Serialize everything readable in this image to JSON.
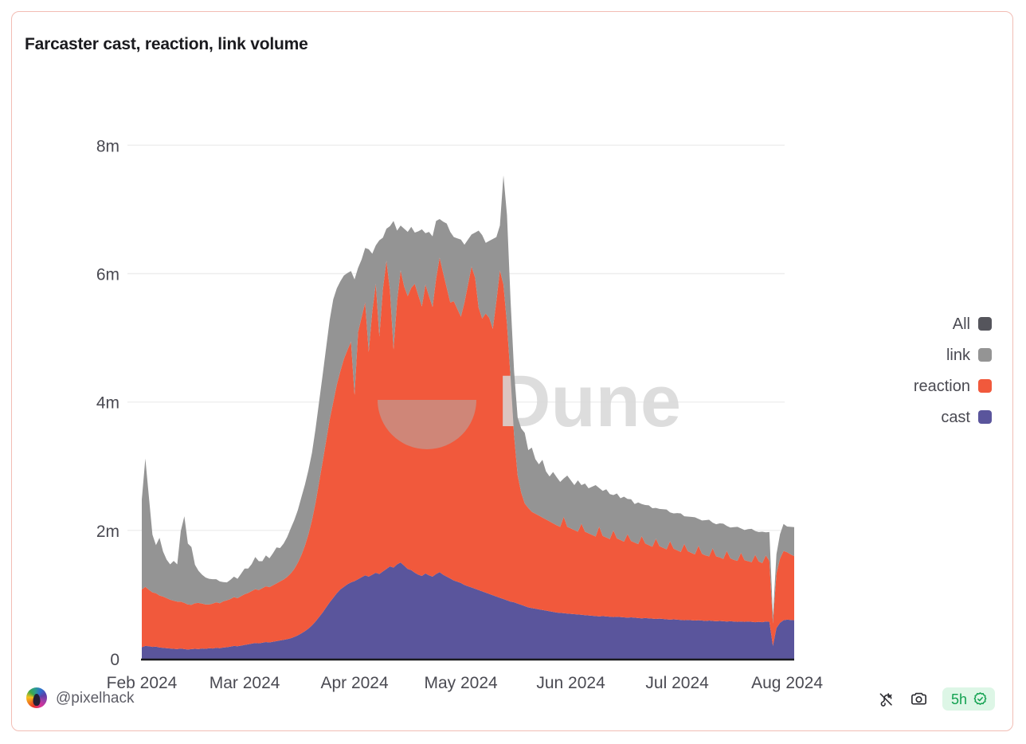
{
  "card": {
    "border_color": "#f2bdb4",
    "background": "#ffffff"
  },
  "header": {
    "title": "Farcaster cast, reaction, link volume"
  },
  "watermark": {
    "text": "Dune",
    "color": "#d8d8d8"
  },
  "legend": {
    "position": "right",
    "items": [
      {
        "label": "All",
        "color": "#55555c"
      },
      {
        "label": "link",
        "color": "#949494"
      },
      {
        "label": "reaction",
        "color": "#f1593c"
      },
      {
        "label": "cast",
        "color": "#5a559c"
      }
    ]
  },
  "footer": {
    "author": "@pixelhack",
    "avatar_icon": "rainbow-avatar-icon",
    "tools": [
      {
        "name": "embed-plug-icon",
        "label": "Embed"
      },
      {
        "name": "camera-icon",
        "label": "Screenshot"
      }
    ],
    "freshness": {
      "value": "5h",
      "icon": "verified-badge-icon",
      "color": "#12a150",
      "background": "#ddf6e6"
    }
  },
  "chart_data": {
    "type": "area",
    "stacked": true,
    "title": "Farcaster cast, reaction, link volume",
    "xlabel": "",
    "ylabel": "",
    "grid": true,
    "legend_position": "right",
    "xlim": [
      "2024-02-01",
      "2024-08-10"
    ],
    "ylim": [
      0,
      8600000
    ],
    "ytick_values": [
      0,
      2000000,
      4000000,
      6000000,
      8000000
    ],
    "ytick_labels": [
      "0",
      "2m",
      "4m",
      "6m",
      "8m"
    ],
    "xtick_labels": [
      "Feb 2024",
      "Mar 2024",
      "Apr 2024",
      "May 2024",
      "Jun 2024",
      "Jul 2024",
      "Aug 2024"
    ],
    "xtick_positions": [
      0,
      29,
      60,
      90,
      121,
      151,
      182
    ],
    "x_unit": "days since 2024-02-01",
    "series": [
      {
        "name": "cast",
        "color": "#5a559c",
        "values": [
          180000,
          200000,
          195000,
          185000,
          190000,
          175000,
          170000,
          165000,
          160000,
          155000,
          150000,
          160000,
          150000,
          145000,
          150000,
          155000,
          150000,
          160000,
          155000,
          165000,
          160000,
          170000,
          165000,
          175000,
          180000,
          190000,
          200000,
          195000,
          205000,
          215000,
          225000,
          235000,
          245000,
          240000,
          250000,
          260000,
          255000,
          265000,
          275000,
          285000,
          295000,
          305000,
          320000,
          340000,
          365000,
          395000,
          430000,
          470000,
          520000,
          580000,
          650000,
          720000,
          800000,
          880000,
          950000,
          1020000,
          1080000,
          1120000,
          1160000,
          1190000,
          1210000,
          1240000,
          1270000,
          1300000,
          1280000,
          1310000,
          1340000,
          1320000,
          1360000,
          1400000,
          1440000,
          1420000,
          1470000,
          1500000,
          1450000,
          1400000,
          1380000,
          1340000,
          1310000,
          1290000,
          1330000,
          1300000,
          1280000,
          1320000,
          1350000,
          1310000,
          1280000,
          1250000,
          1220000,
          1200000,
          1180000,
          1150000,
          1130000,
          1110000,
          1090000,
          1070000,
          1050000,
          1030000,
          1010000,
          990000,
          970000,
          950000,
          930000,
          910000,
          890000,
          880000,
          860000,
          840000,
          820000,
          800000,
          790000,
          780000,
          770000,
          760000,
          750000,
          740000,
          730000,
          720000,
          715000,
          710000,
          705000,
          700000,
          695000,
          690000,
          685000,
          680000,
          675000,
          670000,
          665000,
          660000,
          665000,
          660000,
          655000,
          650000,
          655000,
          650000,
          645000,
          640000,
          645000,
          640000,
          635000,
          630000,
          635000,
          630000,
          625000,
          620000,
          625000,
          620000,
          615000,
          610000,
          615000,
          610000,
          605000,
          600000,
          605000,
          600000,
          595000,
          600000,
          595000,
          590000,
          595000,
          590000,
          585000,
          590000,
          585000,
          580000,
          585000,
          580000,
          575000,
          580000,
          575000,
          580000,
          575000,
          570000,
          575000,
          570000,
          580000,
          575000,
          200000,
          480000,
          560000,
          600000,
          610000,
          605000,
          600000
        ]
      },
      {
        "name": "reaction",
        "color": "#f1593c",
        "values": [
          900000,
          920000,
          880000,
          850000,
          830000,
          810000,
          800000,
          780000,
          760000,
          750000,
          740000,
          730000,
          720000,
          700000,
          690000,
          710000,
          720000,
          700000,
          690000,
          680000,
          700000,
          710000,
          700000,
          720000,
          730000,
          740000,
          760000,
          750000,
          770000,
          790000,
          800000,
          820000,
          840000,
          830000,
          850000,
          870000,
          860000,
          880000,
          900000,
          920000,
          940000,
          970000,
          1010000,
          1060000,
          1130000,
          1220000,
          1330000,
          1470000,
          1640000,
          1850000,
          2100000,
          2350000,
          2600000,
          2850000,
          3050000,
          3250000,
          3400000,
          3550000,
          3650000,
          3750000,
          2900000,
          3850000,
          4050000,
          4250000,
          3500000,
          4100000,
          4500000,
          3700000,
          4400000,
          4800000,
          4300000,
          3400000,
          4100000,
          4550000,
          4350000,
          4250000,
          4400000,
          4500000,
          4350000,
          4200000,
          4500000,
          4350000,
          4200000,
          4600000,
          4900000,
          4700000,
          4500000,
          4300000,
          4350000,
          4250000,
          4150000,
          4400000,
          4700000,
          5000000,
          4850000,
          4400000,
          4250000,
          4350000,
          4300000,
          4150000,
          4600000,
          5100000,
          4900000,
          4300000,
          3500000,
          2600000,
          2000000,
          1750000,
          1600000,
          1550000,
          1500000,
          1480000,
          1460000,
          1440000,
          1420000,
          1400000,
          1380000,
          1360000,
          1340000,
          1500000,
          1350000,
          1330000,
          1310000,
          1290000,
          1420000,
          1300000,
          1280000,
          1260000,
          1240000,
          1400000,
          1250000,
          1230000,
          1210000,
          1350000,
          1220000,
          1200000,
          1180000,
          1300000,
          1190000,
          1170000,
          1150000,
          1280000,
          1160000,
          1140000,
          1120000,
          1250000,
          1130000,
          1110000,
          1090000,
          1220000,
          1100000,
          1080000,
          1060000,
          1190000,
          1070000,
          1050000,
          1030000,
          1160000,
          1040000,
          1020000,
          1000000,
          1130000,
          1010000,
          990000,
          970000,
          1100000,
          980000,
          960000,
          950000,
          1070000,
          960000,
          940000,
          930000,
          1050000,
          940000,
          920000,
          1030000,
          950000,
          350000,
          850000,
          1000000,
          1080000,
          1050000,
          1020000,
          1000000
        ]
      },
      {
        "name": "link",
        "color": "#949494",
        "values": [
          1400000,
          2000000,
          1450000,
          900000,
          750000,
          900000,
          700000,
          600000,
          550000,
          620000,
          580000,
          1100000,
          1350000,
          950000,
          900000,
          600000,
          500000,
          450000,
          420000,
          400000,
          380000,
          360000,
          340000,
          300000,
          280000,
          300000,
          320000,
          300000,
          350000,
          400000,
          380000,
          420000,
          500000,
          450000,
          420000,
          480000,
          450000,
          500000,
          560000,
          520000,
          560000,
          620000,
          700000,
          760000,
          820000,
          900000,
          950000,
          1000000,
          1050000,
          1150000,
          1250000,
          1350000,
          1450000,
          1550000,
          1600000,
          1500000,
          1400000,
          1300000,
          1200000,
          1100000,
          1800000,
          1000000,
          900000,
          850000,
          1600000,
          900000,
          600000,
          1500000,
          800000,
          500000,
          1000000,
          2000000,
          1100000,
          700000,
          900000,
          1000000,
          950000,
          800000,
          1000000,
          1200000,
          800000,
          1000000,
          1100000,
          900000,
          600000,
          800000,
          1000000,
          1100000,
          1000000,
          1100000,
          1200000,
          900000,
          700000,
          500000,
          700000,
          1200000,
          1300000,
          1100000,
          1200000,
          1400000,
          1000000,
          700000,
          1700000,
          1700000,
          1200000,
          1000000,
          900000,
          1000000,
          1100000,
          900000,
          1000000,
          850000,
          800000,
          900000,
          750000,
          700000,
          800000,
          750000,
          700000,
          600000,
          800000,
          750000,
          700000,
          800000,
          600000,
          750000,
          700000,
          750000,
          800000,
          600000,
          700000,
          750000,
          700000,
          550000,
          700000,
          650000,
          700000,
          550000,
          650000,
          600000,
          650000,
          500000,
          600000,
          620000,
          600000,
          480000,
          580000,
          600000,
          620000,
          450000,
          550000,
          580000,
          600000,
          430000,
          540000,
          560000,
          580000,
          420000,
          520000,
          550000,
          570000,
          400000,
          500000,
          530000,
          550000,
          390000,
          480000,
          510000,
          530000,
          380000,
          470000,
          500000,
          520000,
          370000,
          460000,
          490000,
          360000,
          450000,
          120000,
          300000,
          380000,
          420000,
          400000,
          430000,
          450000
        ]
      }
    ]
  }
}
